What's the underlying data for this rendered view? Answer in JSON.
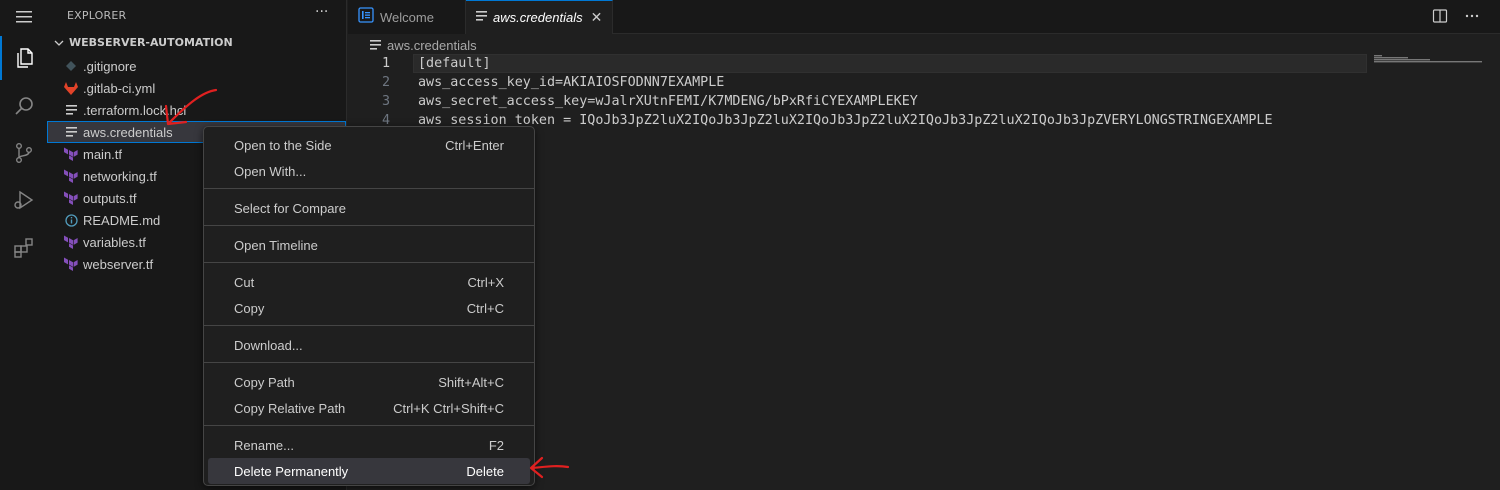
{
  "sidebar": {
    "title": "EXPLORER",
    "more": "···",
    "folder": "WEBSERVER-AUTOMATION",
    "files": [
      {
        "name": ".gitignore",
        "icon": "gitignore-icon"
      },
      {
        "name": ".gitlab-ci.yml",
        "icon": "gitlab-icon"
      },
      {
        "name": ".terraform.lock.hcl",
        "icon": "lines-file-icon"
      },
      {
        "name": "aws.credentials",
        "icon": "lines-file-icon"
      },
      {
        "name": "main.tf",
        "icon": "terraform-icon"
      },
      {
        "name": "networking.tf",
        "icon": "terraform-icon"
      },
      {
        "name": "outputs.tf",
        "icon": "terraform-icon"
      },
      {
        "name": "README.md",
        "icon": "info-icon"
      },
      {
        "name": "variables.tf",
        "icon": "terraform-icon"
      },
      {
        "name": "webserver.tf",
        "icon": "terraform-icon"
      }
    ]
  },
  "tabs": [
    {
      "label": "Welcome",
      "active": false
    },
    {
      "label": "aws.credentials",
      "active": true,
      "close": "✕"
    }
  ],
  "breadcrumb": "aws.credentials",
  "editor": {
    "lines": [
      {
        "num": "1",
        "text": "[default]"
      },
      {
        "num": "2",
        "text": "aws_access_key_id=AKIAIOSFODNN7EXAMPLE"
      },
      {
        "num": "3",
        "text": "aws_secret_access_key=wJalrXUtnFEMI/K7MDENG/bPxRfiCYEXAMPLEKEY"
      },
      {
        "num": "4",
        "text": "aws_session_token = IQoJb3JpZ2luX2IQoJb3JpZ2luX2IQoJb3JpZ2luX2IQoJb3JpZ2luX2IQoJb3JpZVERYLONGSTRINGEXAMPLE"
      }
    ]
  },
  "context_menu": {
    "items": [
      {
        "label": "Open to the Side",
        "key": "Ctrl+Enter"
      },
      {
        "label": "Open With...",
        "key": ""
      },
      {
        "label": "Select for Compare",
        "key": ""
      },
      {
        "label": "Open Timeline",
        "key": ""
      },
      {
        "label": "Cut",
        "key": "Ctrl+X"
      },
      {
        "label": "Copy",
        "key": "Ctrl+C"
      },
      {
        "label": "Download...",
        "key": ""
      },
      {
        "label": "Copy Path",
        "key": "Shift+Alt+C"
      },
      {
        "label": "Copy Relative Path",
        "key": "Ctrl+K Ctrl+Shift+C"
      },
      {
        "label": "Rename...",
        "key": "F2"
      },
      {
        "label": "Delete Permanently",
        "key": "Delete"
      }
    ]
  },
  "colors": {
    "accent": "#0078d4",
    "terraform": "#844fba",
    "gitlab": "#e24329",
    "annotation": "#e02020"
  }
}
